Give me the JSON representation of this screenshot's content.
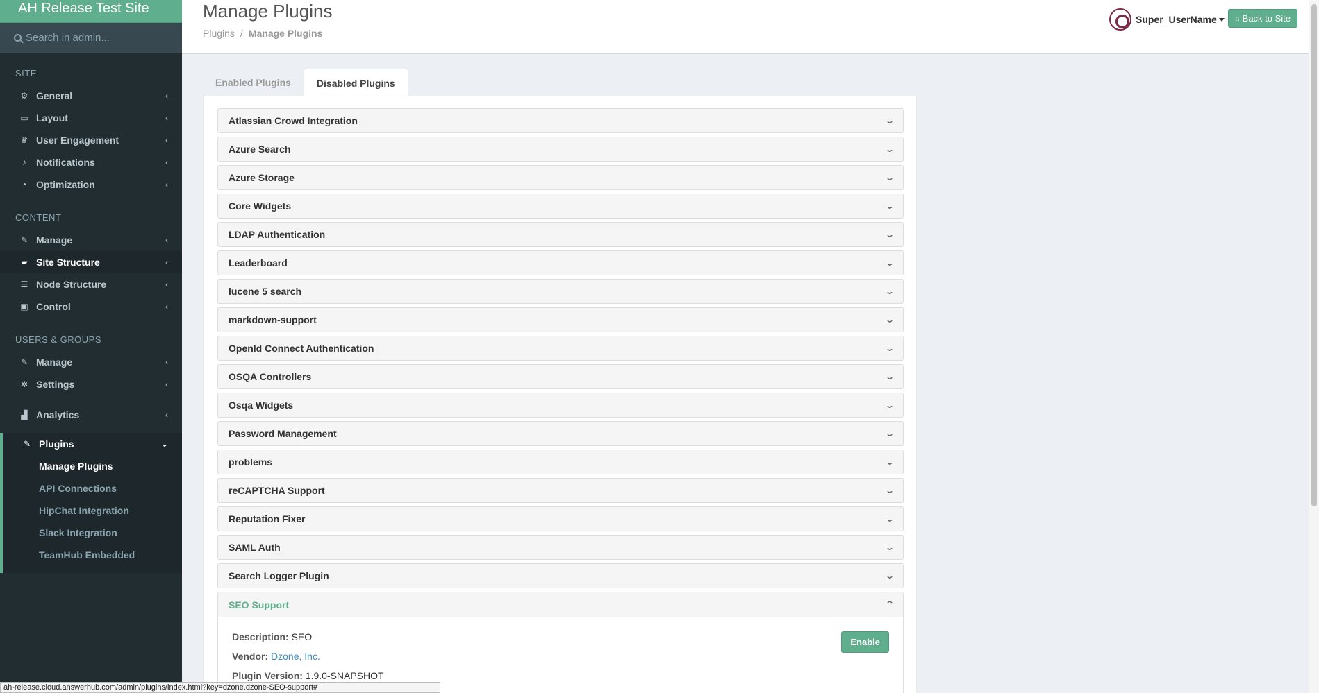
{
  "sidebar": {
    "brand": "AH Release Test Site",
    "search_placeholder": "Search in admin...",
    "site_header": "SITE",
    "site_items": [
      {
        "label": "General",
        "icon": "cogs-icon"
      },
      {
        "label": "Layout",
        "icon": "desktop-icon"
      },
      {
        "label": "User Engagement",
        "icon": "trophy-icon"
      },
      {
        "label": "Notifications",
        "icon": "bell-icon"
      },
      {
        "label": "Optimization",
        "icon": "dashboard-icon"
      }
    ],
    "content_header": "CONTENT",
    "content_items": [
      {
        "label": "Manage",
        "icon": "wrench-icon"
      },
      {
        "label": "Site Structure",
        "icon": "folder-open-icon"
      },
      {
        "label": "Node Structure",
        "icon": "list-icon"
      },
      {
        "label": "Control",
        "icon": "lock-icon"
      }
    ],
    "users_header": "USERS & GROUPS",
    "users_items": [
      {
        "label": "Manage",
        "icon": "wrench-icon"
      },
      {
        "label": "Settings",
        "icon": "gear-icon"
      }
    ],
    "analytics": {
      "label": "Analytics",
      "icon": "area-chart-icon"
    },
    "plugins": {
      "label": "Plugins",
      "icon": "plug-icon",
      "sub_items": [
        "Manage Plugins",
        "API Connections",
        "HipChat Integration",
        "Slack Integration",
        "TeamHub Embedded"
      ]
    }
  },
  "header": {
    "title": "Manage Plugins",
    "breadcrumb_root": "Plugins",
    "breadcrumb_sep": "/",
    "breadcrumb_current": "Manage Plugins",
    "username": "Super_UserName",
    "back_label": "Back to Site"
  },
  "tabs": [
    "Enabled Plugins",
    "Disabled Plugins"
  ],
  "plugins": [
    "Atlassian Crowd Integration",
    "Azure Search",
    "Azure Storage",
    "Core Widgets",
    "LDAP Authentication",
    "Leaderboard",
    "lucene 5 search",
    "markdown-support",
    "OpenId Connect Authentication",
    "OSQA Controllers",
    "Osqa Widgets",
    "Password Management",
    "problems",
    "reCAPTCHA Support",
    "Reputation Fixer",
    "SAML Auth",
    "Search Logger Plugin"
  ],
  "expanded": {
    "title": "SEO Support",
    "description_label": "Description:",
    "description": "SEO",
    "vendor_label": "Vendor:",
    "vendor": "Dzone, Inc.",
    "version_label": "Plugin Version:",
    "version": "1.9.0-SNAPSHOT",
    "enable_label": "Enable"
  },
  "status_url": "ah-release.cloud.answerhub.com/admin/plugins/index.html?key=dzone.dzone-SEO-support#"
}
